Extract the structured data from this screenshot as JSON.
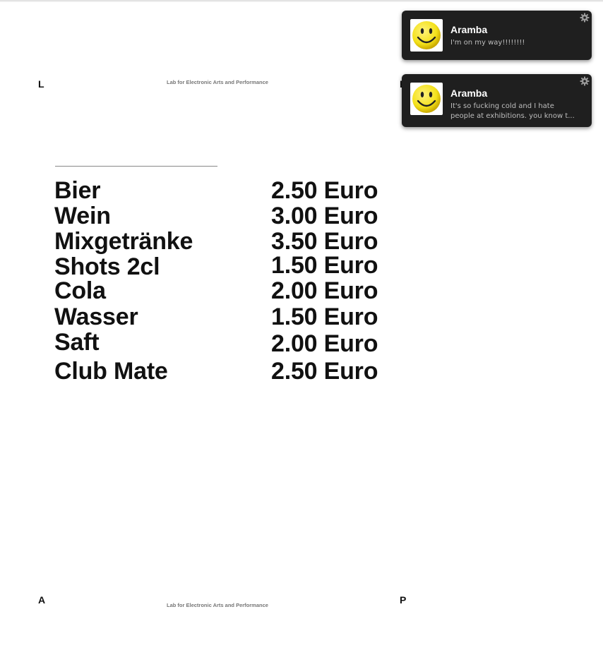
{
  "document": {
    "corner_letters": {
      "top_left": "L",
      "top_right": "E",
      "bottom_left": "A",
      "bottom_right": "P"
    },
    "lab_name_top": "Lab for Electronic Arts and Performance",
    "lab_name_bottom": "Lab for Electronic Arts and Performance",
    "menu": [
      {
        "item": "Bier",
        "price": "2.50 Euro"
      },
      {
        "item": "Wein",
        "price": "3.00 Euro"
      },
      {
        "item": "Mixgetränke",
        "price": "3.50 Euro"
      },
      {
        "item": "Shots 2cl",
        "price": "1.50 Euro"
      },
      {
        "item": "Cola",
        "price": "2.00 Euro"
      },
      {
        "item": "Wasser",
        "price": "1.50 Euro"
      },
      {
        "item": "Saft",
        "price": "2.00 Euro"
      },
      {
        "item": "Club Mate",
        "price": "2.50 Euro"
      }
    ]
  },
  "notifications": [
    {
      "title": "Aramba",
      "message": "I'm on my way!!!!!!!!",
      "icon": "smiley-avatar-icon",
      "settings_icon": "gear-icon"
    },
    {
      "title": "Aramba",
      "message_line_1": "It's so fucking cold and I hate",
      "message_line_2": "people at exhibitions. you know t...",
      "icon": "smiley-avatar-icon",
      "settings_icon": "gear-icon"
    }
  ],
  "colors": {
    "notification_bg": "#1f1f1f",
    "smiley_yellow": "#f3e11a",
    "text_dark": "#111111"
  }
}
